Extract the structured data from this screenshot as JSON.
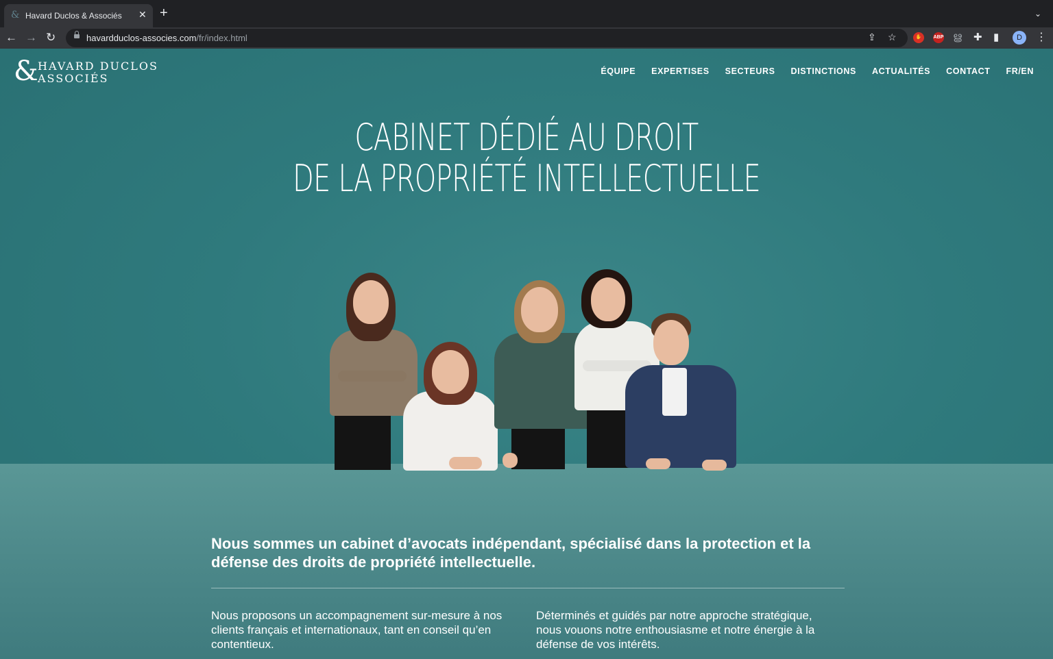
{
  "browser": {
    "tab_title": "Havard Duclos & Associés",
    "tab_favicon": "&",
    "url_host": "havardduclos-associes.com",
    "url_path": "/fr/index.html",
    "avatar_initial": "D",
    "extensions": [
      "share-icon",
      "bookmark-star-icon",
      "adblock-stop-icon",
      "abp-icon",
      "reader-icon",
      "extensions-puzzle-icon",
      "side-panel-icon"
    ],
    "abp_label": "ABP"
  },
  "site": {
    "logo": {
      "amp": "&",
      "line1": "HAVARD DUCLOS",
      "line2": "ASSOCIÉS"
    },
    "nav": [
      "ÉQUIPE",
      "EXPERTISES",
      "SECTEURS",
      "DISTINCTIONS",
      "ACTUALITÉS",
      "CONTACT",
      "FR/EN"
    ],
    "hero": {
      "line1": "CABINET DÉDIÉ AU DROIT",
      "line2": "DE LA PROPRIÉTÉ INTELLECTUELLE"
    },
    "intro": "Nous sommes un cabinet d’avocats indépendant, spécialisé dans la protection et la défense des droits de propriété intellectuelle.",
    "columns": [
      "Nous proposons un accompagnement sur-mesure à nos clients français et internationaux, tant en conseil qu’en contentieux.",
      "Déterminés et guidés par notre approche stratégique, nous vouons notre enthousiasme et notre énergie à la défense de vos intérêts."
    ],
    "colors": {
      "background": "#2f7a7d",
      "floor": "#4f8b8c",
      "text": "#ffffff"
    }
  }
}
